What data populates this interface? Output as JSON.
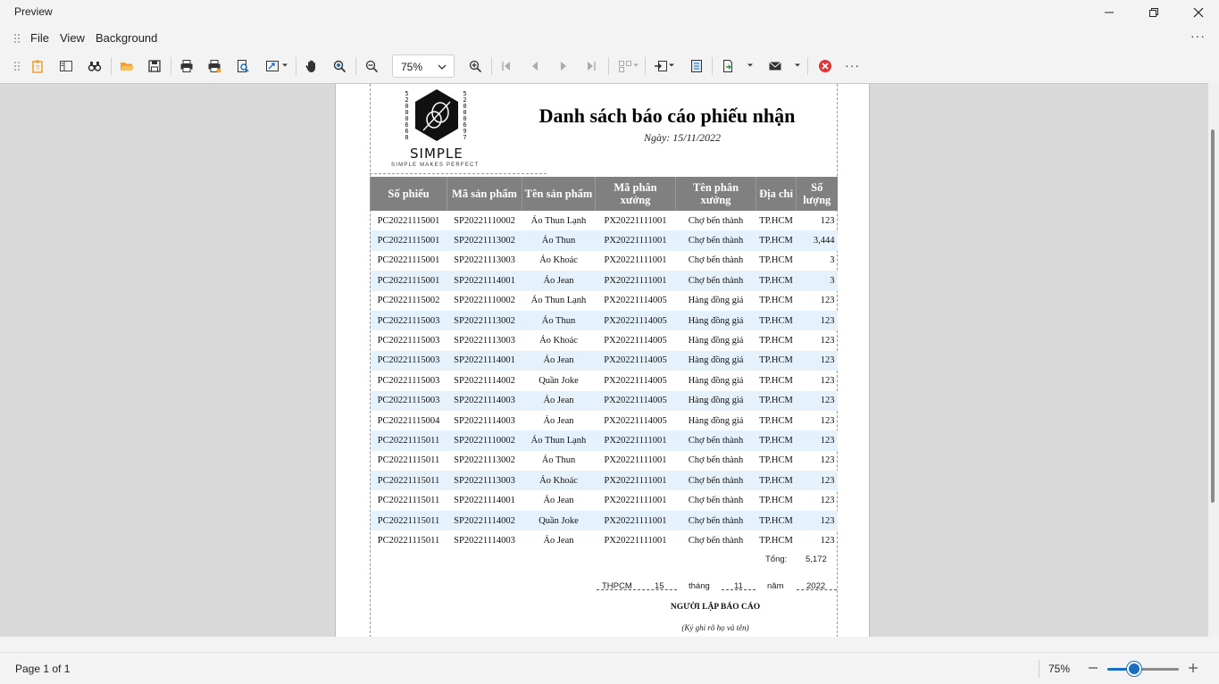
{
  "window": {
    "title": "Preview"
  },
  "menu": {
    "file": "File",
    "view": "View",
    "background": "Background"
  },
  "toolbar": {
    "zoom_value": "75%"
  },
  "report": {
    "title": "Danh sách báo cáo phiếu nhận",
    "date": "Ngày: 15/11/2022",
    "logo": {
      "word": "SIMPLE",
      "tagline": "SIMPLE MAKES PERFECT",
      "left_digits": [
        "5",
        "2",
        "0",
        "0",
        "0",
        "6",
        "6",
        "8"
      ],
      "right_digits": [
        "5",
        "2",
        "0",
        "0",
        "0",
        "6",
        "9",
        "7"
      ]
    },
    "columns": [
      "Số phiếu",
      "Mã sản phẩm",
      "Tên sản phẩm",
      "Mã phân xưởng",
      "Tên phân xưởng",
      "Địa chỉ",
      "Số lượng"
    ],
    "rows": [
      [
        "PC20221115001",
        "SP20221110002",
        "Áo Thun Lạnh",
        "PX20221111001",
        "Chợ bến thành",
        "TP.HCM",
        "123"
      ],
      [
        "PC20221115001",
        "SP20221113002",
        "Áo Thun",
        "PX20221111001",
        "Chợ bến thành",
        "TP.HCM",
        "3,444"
      ],
      [
        "PC20221115001",
        "SP20221113003",
        "Áo Khoác",
        "PX20221111001",
        "Chợ bến thành",
        "TP.HCM",
        "3"
      ],
      [
        "PC20221115001",
        "SP20221114001",
        "Áo Jean",
        "PX20221111001",
        "Chợ bến thành",
        "TP.HCM",
        "3"
      ],
      [
        "PC20221115002",
        "SP20221110002",
        "Áo Thun Lạnh",
        "PX20221114005",
        "Hàng đồng giá",
        "TP.HCM",
        "123"
      ],
      [
        "PC20221115003",
        "SP20221113002",
        "Áo Thun",
        "PX20221114005",
        "Hàng đồng giá",
        "TP.HCM",
        "123"
      ],
      [
        "PC20221115003",
        "SP20221113003",
        "Áo Khoác",
        "PX20221114005",
        "Hàng đồng giá",
        "TP.HCM",
        "123"
      ],
      [
        "PC20221115003",
        "SP20221114001",
        "Áo Jean",
        "PX20221114005",
        "Hàng đồng giá",
        "TP.HCM",
        "123"
      ],
      [
        "PC20221115003",
        "SP20221114002",
        "Quần Joke",
        "PX20221114005",
        "Hàng đồng giá",
        "TP.HCM",
        "123"
      ],
      [
        "PC20221115003",
        "SP20221114003",
        "Áo Jean",
        "PX20221114005",
        "Hàng đồng giá",
        "TP.HCM",
        "123"
      ],
      [
        "PC20221115004",
        "SP20221114003",
        "Áo Jean",
        "PX20221114005",
        "Hàng đồng giá",
        "TP.HCM",
        "123"
      ],
      [
        "PC20221115011",
        "SP20221110002",
        "Áo Thun Lạnh",
        "PX20221111001",
        "Chợ bến thành",
        "TP.HCM",
        "123"
      ],
      [
        "PC20221115011",
        "SP20221113002",
        "Áo Thun",
        "PX20221111001",
        "Chợ bến thành",
        "TP.HCM",
        "123"
      ],
      [
        "PC20221115011",
        "SP20221113003",
        "Áo Khoác",
        "PX20221111001",
        "Chợ bến thành",
        "TP.HCM",
        "123"
      ],
      [
        "PC20221115011",
        "SP20221114001",
        "Áo Jean",
        "PX20221111001",
        "Chợ bến thành",
        "TP.HCM",
        "123"
      ],
      [
        "PC20221115011",
        "SP20221114002",
        "Quần Joke",
        "PX20221111001",
        "Chợ bến thành",
        "TP.HCM",
        "123"
      ],
      [
        "PC20221115011",
        "SP20221114003",
        "Áo Jean",
        "PX20221111001",
        "Chợ bến thành",
        "TP.HCM",
        "123"
      ]
    ],
    "total_label": "Tổng:",
    "total_value": "5,172",
    "place": "THPCM",
    "day": "15",
    "month_label": "tháng",
    "month": "11",
    "year_label": "năm",
    "year": "2022",
    "signer_title": "NGƯỜI LẬP BÁO CÁO",
    "signer_note": "(Ký ghi rõ họ và tên)"
  },
  "status": {
    "page": "Page 1 of 1",
    "zoom": "75%",
    "zoom_level": 0.375
  },
  "colors": {
    "header_bg": "#808080",
    "alt_row": "#e6f2fb",
    "accent": "#1a6ec0",
    "export_icon": "#f0a030",
    "close_red": "#e03535"
  }
}
